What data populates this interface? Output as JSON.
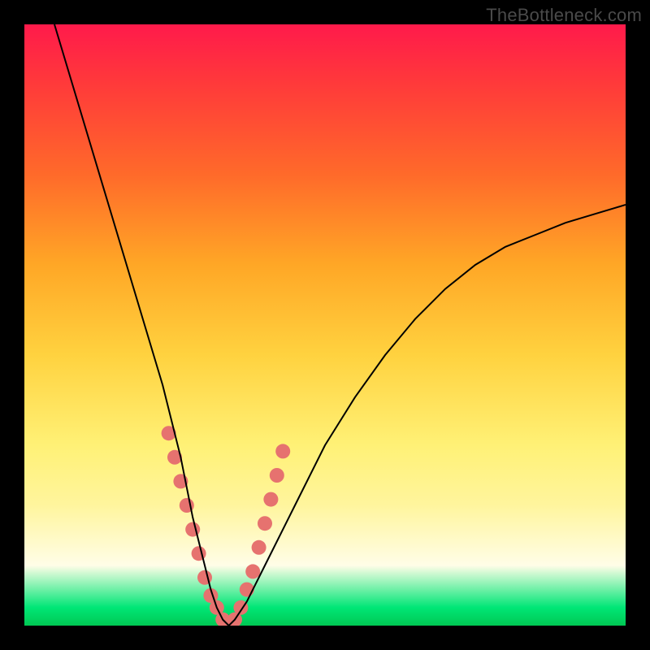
{
  "watermark": "TheBottleneck.com",
  "chart_data": {
    "type": "line",
    "title": "",
    "xlabel": "",
    "ylabel": "",
    "xlim": [
      0,
      100
    ],
    "ylim": [
      0,
      100
    ],
    "grid": false,
    "legend": false,
    "background_gradient_stops": [
      {
        "pos": 0,
        "color": "#ff1a4b"
      },
      {
        "pos": 10,
        "color": "#ff3a3a"
      },
      {
        "pos": 25,
        "color": "#ff6a2a"
      },
      {
        "pos": 40,
        "color": "#ffa726"
      },
      {
        "pos": 55,
        "color": "#ffd23f"
      },
      {
        "pos": 70,
        "color": "#fff176"
      },
      {
        "pos": 80,
        "color": "#fff59d"
      },
      {
        "pos": 90,
        "color": "#fffde7"
      },
      {
        "pos": 97,
        "color": "#00e676"
      },
      {
        "pos": 100,
        "color": "#00c853"
      }
    ],
    "series": [
      {
        "name": "bottleneck-curve",
        "stroke": "#000000",
        "stroke_width": 2,
        "x": [
          5,
          8,
          11,
          14,
          17,
          20,
          23,
          26,
          28,
          30,
          31,
          32,
          33,
          34,
          35,
          37,
          40,
          45,
          50,
          55,
          60,
          65,
          70,
          75,
          80,
          85,
          90,
          95,
          100
        ],
        "y": [
          100,
          90,
          80,
          70,
          60,
          50,
          40,
          28,
          18,
          10,
          6,
          3,
          1,
          0,
          1,
          4,
          10,
          20,
          30,
          38,
          45,
          51,
          56,
          60,
          63,
          65,
          67,
          68.5,
          70
        ]
      },
      {
        "name": "highlight-dots",
        "type": "scatter",
        "marker_color": "#e6726f",
        "marker_radius_px": 9,
        "x": [
          24,
          25,
          26,
          27,
          28,
          29,
          30,
          31,
          32,
          33,
          34,
          35,
          36,
          37,
          38,
          39,
          40,
          41,
          42,
          43
        ],
        "y": [
          32,
          28,
          24,
          20,
          16,
          12,
          8,
          5,
          3,
          1,
          0,
          1,
          3,
          6,
          9,
          13,
          17,
          21,
          25,
          29
        ]
      }
    ]
  }
}
